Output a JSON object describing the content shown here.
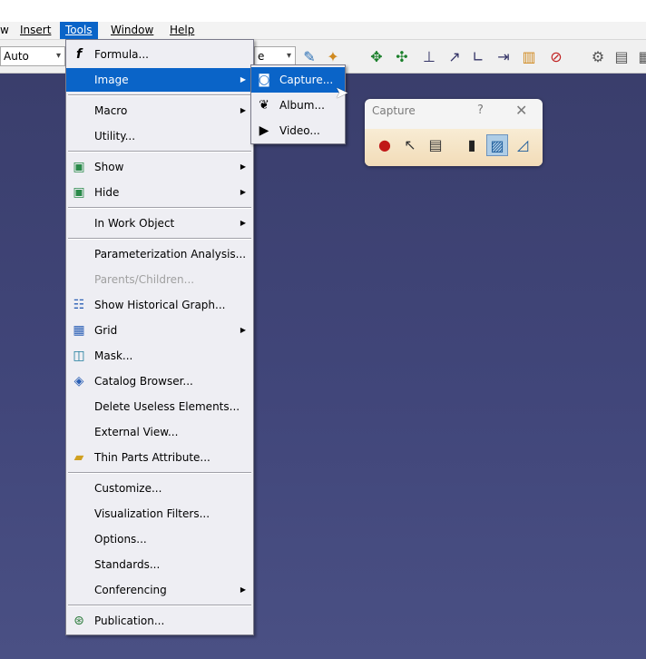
{
  "menubar": {
    "items": [
      {
        "label": "w",
        "name": "menu-view-partial"
      },
      {
        "label": "Insert",
        "name": "menu-insert"
      },
      {
        "label": "Tools",
        "name": "menu-tools"
      },
      {
        "label": "Window",
        "name": "menu-window"
      },
      {
        "label": "Help",
        "name": "menu-help"
      }
    ]
  },
  "toolbar": {
    "combo1_value": "Auto",
    "combo2_value": "e"
  },
  "tools_menu": {
    "items": {
      "formula": "Formula...",
      "image": "Image",
      "macro": "Macro",
      "utility": "Utility...",
      "show": "Show",
      "hide": "Hide",
      "in_work_object": "In Work Object",
      "parameterization": "Parameterization Analysis...",
      "parents_children": "Parents/Children...",
      "show_historical": "Show Historical Graph...",
      "grid": "Grid",
      "mask": "Mask...",
      "catalog": "Catalog Browser...",
      "delete_useless": "Delete Useless Elements...",
      "external_view": "External View...",
      "thin_parts": "Thin Parts Attribute...",
      "customize": "Customize...",
      "vis_filters": "Visualization Filters...",
      "options": "Options...",
      "standards": "Standards...",
      "conferencing": "Conferencing",
      "publication": "Publication..."
    }
  },
  "image_submenu": {
    "capture": "Capture...",
    "album": "Album...",
    "video": "Video..."
  },
  "capture_toolbar": {
    "title": "Capture",
    "help": "?",
    "close": "✕"
  },
  "colors": {
    "highlight": "#0a64c8",
    "menu_bg": "#eeeef3",
    "viewport_top": "#3a3e6c"
  }
}
